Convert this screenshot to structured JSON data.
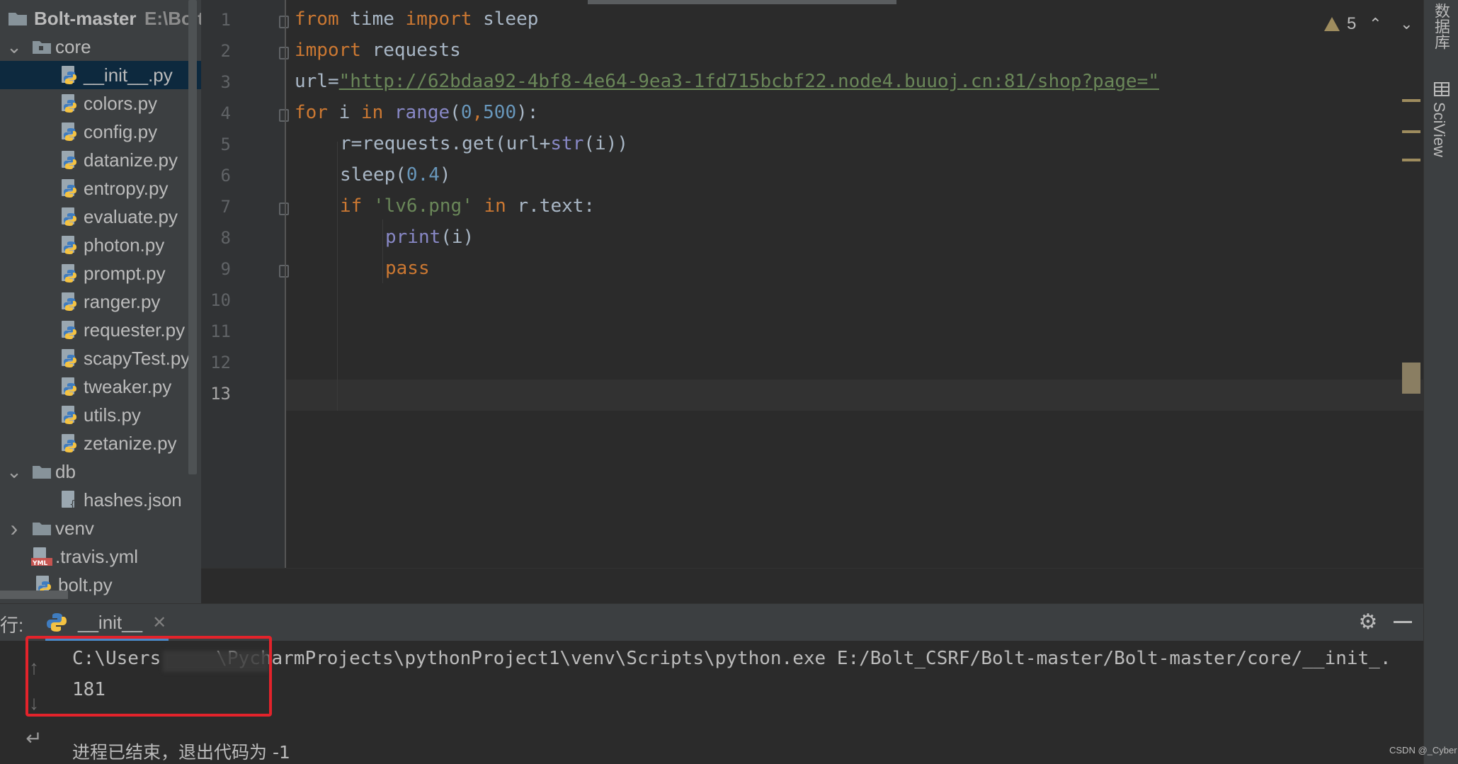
{
  "project": {
    "root_name": "Bolt-master",
    "root_path": "E:\\Bolt_",
    "items": [
      {
        "label": "core",
        "kind": "folder-open"
      },
      {
        "label": "__init__.py",
        "kind": "python",
        "selected": true
      },
      {
        "label": "colors.py",
        "kind": "python"
      },
      {
        "label": "config.py",
        "kind": "python"
      },
      {
        "label": "datanize.py",
        "kind": "python"
      },
      {
        "label": "entropy.py",
        "kind": "python"
      },
      {
        "label": "evaluate.py",
        "kind": "python"
      },
      {
        "label": "photon.py",
        "kind": "python"
      },
      {
        "label": "prompt.py",
        "kind": "python"
      },
      {
        "label": "ranger.py",
        "kind": "python"
      },
      {
        "label": "requester.py",
        "kind": "python"
      },
      {
        "label": "scapyTest.py",
        "kind": "python"
      },
      {
        "label": "tweaker.py",
        "kind": "python"
      },
      {
        "label": "utils.py",
        "kind": "python"
      },
      {
        "label": "zetanize.py",
        "kind": "python"
      },
      {
        "label": "db",
        "kind": "folder-open"
      },
      {
        "label": "hashes.json",
        "kind": "json"
      },
      {
        "label": "venv",
        "kind": "folder-closed"
      },
      {
        "label": ".travis.yml",
        "kind": "yaml"
      },
      {
        "label": "bolt.py",
        "kind": "python"
      }
    ]
  },
  "editor": {
    "line_numbers": [
      "1",
      "2",
      "3",
      "4",
      "5",
      "6",
      "7",
      "8",
      "9",
      "10",
      "11",
      "12",
      "13"
    ],
    "active_line": "13",
    "inspection_count": "5",
    "code": {
      "l1": {
        "from": "from",
        "mod": " time ",
        "import": "import",
        "name": " sleep"
      },
      "l2": {
        "import": "import",
        "name": " requests"
      },
      "l3": {
        "var": "url=",
        "url": "\"http://62bdaa92-4bf8-4e64-9ea3-1fd715bcbf22.node4.buuoj.cn:81/shop?page=\""
      },
      "l4": {
        "for": "for",
        "i": " i ",
        "in": "in",
        "range": " range",
        "open": "(",
        "n0": "0",
        "comma": ",",
        "n500": "500",
        "close": "):"
      },
      "l5": {
        "pre": "r=requests.get(url+",
        "str": "str",
        "post": "(i))"
      },
      "l6": {
        "pre": "sleep(",
        "num": "0.4",
        "post": ")"
      },
      "l7": {
        "if": "if",
        "sp": " ",
        "lit": "'lv6.png'",
        "sp2": " ",
        "in": "in",
        "post": " r.text:"
      },
      "l8": {
        "print": "print",
        "post": "(i)"
      },
      "l9": {
        "pass": "pass"
      }
    }
  },
  "right_strip": {
    "database": "数据库",
    "sciview": "SciView"
  },
  "run": {
    "label": "行:",
    "tab_name": "__init__",
    "console": {
      "command_prefix": "C:\\Users",
      "command_suffix": "\\PycharmProjects\\pythonProject1\\venv\\Scripts\\python.exe E:/Bolt_CSRF/Bolt-master/Bolt-master/core/__init_.",
      "output": "181",
      "exit": "进程已结束，退出代码为 -1"
    }
  },
  "watermark": "CSDN @_Cyber",
  "colors": {
    "keyword": "#cc7832",
    "string": "#6a8759",
    "number": "#6897bb",
    "builtin": "#8888c6",
    "highlight": "#e3232b"
  }
}
